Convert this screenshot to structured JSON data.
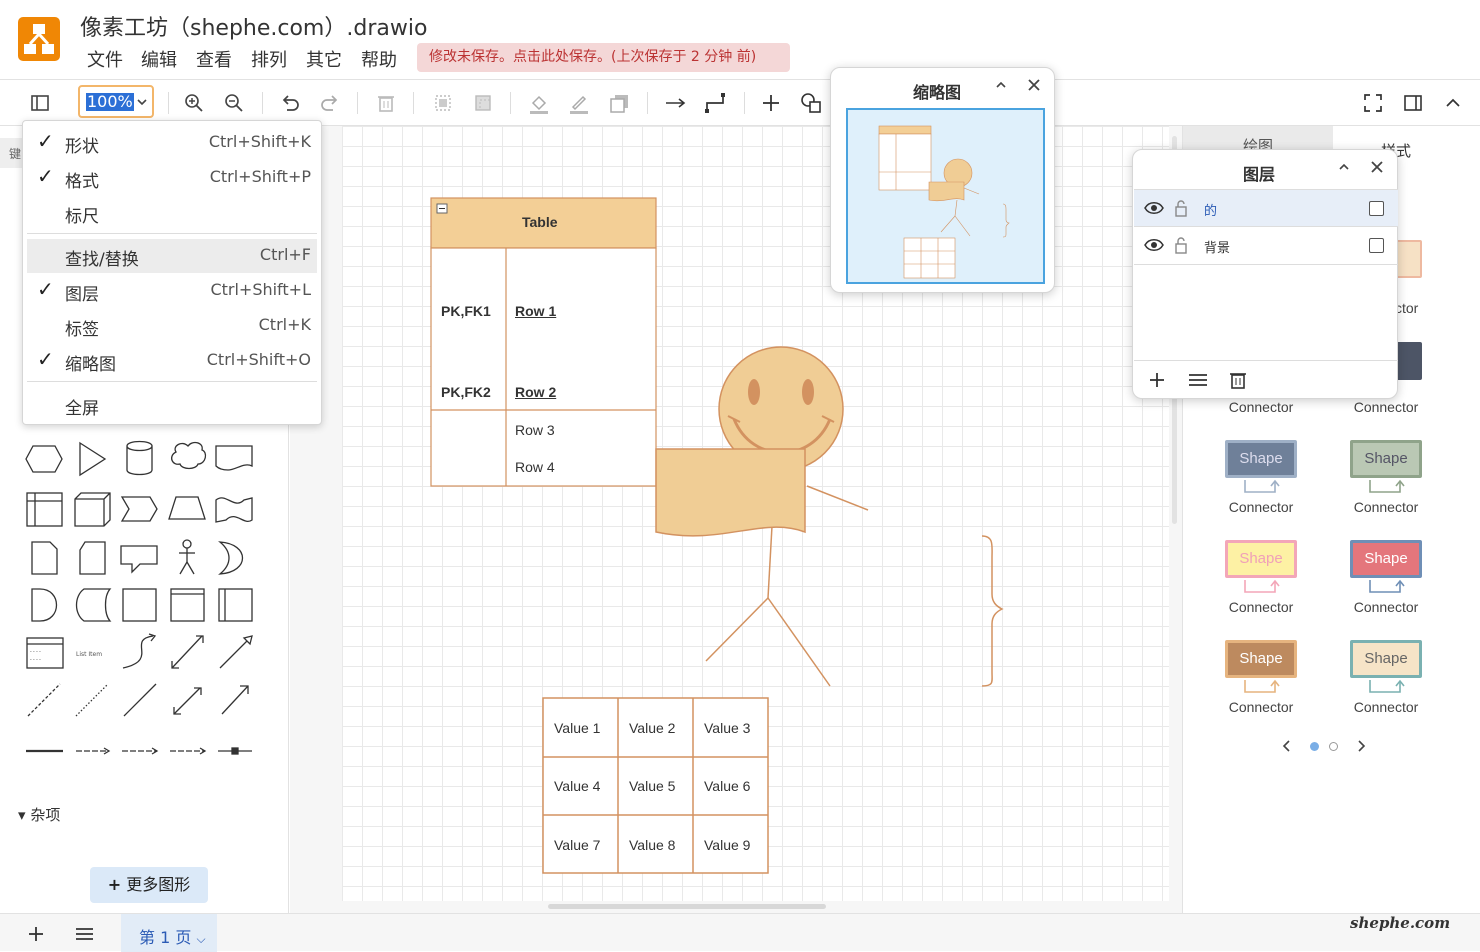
{
  "app": {
    "title": "像素工坊（shephe.com）.drawio"
  },
  "menu": [
    "文件",
    "编辑",
    "查看",
    "排列",
    "其它",
    "帮助"
  ],
  "save_notice": "修改未保存。点击此处保存。(上次保存于 2 分钟 前)",
  "toolbar": {
    "zoom": "100%"
  },
  "view_menu": {
    "items": [
      {
        "label": "形状",
        "shortcut": "Ctrl+Shift+K",
        "checked": true
      },
      {
        "label": "格式",
        "shortcut": "Ctrl+Shift+P",
        "checked": true
      },
      {
        "label": "标尺",
        "shortcut": "",
        "checked": false
      },
      {
        "label": "查找/替换",
        "shortcut": "Ctrl+F",
        "checked": false,
        "highlighted": true
      },
      {
        "label": "图层",
        "shortcut": "Ctrl+Shift+L",
        "checked": true
      },
      {
        "label": "标签",
        "shortcut": "Ctrl+K",
        "checked": false
      },
      {
        "label": "缩略图",
        "shortcut": "Ctrl+Shift+O",
        "checked": true
      },
      {
        "label": "全屏",
        "shortcut": "",
        "checked": false
      }
    ],
    "check_mark": "✓"
  },
  "outline": {
    "title": "缩略图"
  },
  "layers": {
    "title": "图层",
    "items": [
      {
        "name": "的",
        "selected": true
      },
      {
        "name": "背景",
        "selected": false
      }
    ]
  },
  "left_panel": {
    "search_hint": "键",
    "misc_label": "杂项",
    "more_shapes": "更多图形",
    "list_item_label": "List Item"
  },
  "diagram": {
    "table_title": "Table",
    "rows": [
      {
        "key": "PK,FK1",
        "name": "Row 1"
      },
      {
        "key": "PK,FK2",
        "name": "Row 2"
      },
      {
        "key": "",
        "name": "Row 3"
      },
      {
        "key": "",
        "name": "Row 4"
      }
    ],
    "grid_values": [
      "Value 1",
      "Value 2",
      "Value 3",
      "Value 4",
      "Value 5",
      "Value 6",
      "Value 7",
      "Value 8",
      "Value 9"
    ]
  },
  "right_panel": {
    "tab_diagram": "绘图",
    "tab_style": "样式",
    "partial_shape": "e",
    "partial_conn": "ctor",
    "styles": [
      {
        "shape": "Shape",
        "connector": "Connector",
        "fill": "#6f8099",
        "stroke": "#9fb0c6",
        "text": "#dde"
      },
      {
        "shape": "Shape",
        "connector": "Connector",
        "fill": "#bac8b4",
        "stroke": "#8fa38a",
        "text": "#556"
      },
      {
        "shape": "Shape",
        "connector": "Connector",
        "fill": "#fdf1a4",
        "stroke": "#f3a6b8",
        "text": "#f0a0b8"
      },
      {
        "shape": "Shape",
        "connector": "Connector",
        "fill": "#e4767c",
        "stroke": "#6f8fb6",
        "text": "#fff"
      },
      {
        "shape": "Shape",
        "connector": "Connector",
        "fill": "#bd8a5f",
        "stroke": "#e6b47f",
        "text": "#fff"
      },
      {
        "shape": "Shape",
        "connector": "Connector",
        "fill": "#f6e4c7",
        "stroke": "#7ab1b1",
        "text": "#666"
      }
    ],
    "row_prev_conn": "Connector"
  },
  "bottom": {
    "page_label": "第 1 页"
  },
  "watermark": "shephe.com",
  "colors": {
    "accent": "#2b6fd6",
    "drawio_orange": "#f08705",
    "shape_fill": "#f0cd95",
    "shape_stroke": "#d39260",
    "table_header": "#f3cf96"
  }
}
